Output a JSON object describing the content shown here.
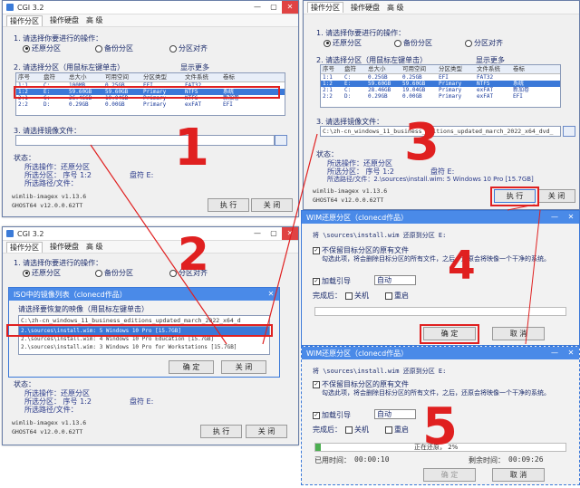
{
  "app_title": "CGI 3.2",
  "menu": {
    "tab1": "操作分区",
    "tab2": "操作硬盘",
    "tab3": "高 级"
  },
  "partition_cols": [
    "序号",
    "盘符",
    "总大小",
    "可用空间",
    "分区类型",
    "文件系统",
    "卷标"
  ],
  "panel1": {
    "section_op": "1. 请选择你要进行的操作：",
    "op_restore": "还原分区",
    "op_backup": "备份分区",
    "op_align": "分区对齐",
    "section_part": "2. 请选择分区（用鼠标左键单击）",
    "show_more": "显示更多",
    "section_image": "3. 请选择镜像文件：",
    "status_label": "状态：",
    "status_op": "所选操作：还原分区",
    "status_part_prefix": "所选分区：   序号 1:2",
    "status_drive": "盘符 E:",
    "status_image": "所选路径/文件：",
    "footer_version": "wimlib-imagex v1.13.6",
    "footer_ghost": "GHOST64 v12.0.0.62TT",
    "btn_exec": "执 行",
    "btn_close": "关 闭",
    "rows": [
      [
        "1:1",
        "C:",
        "100MB",
        "0.25GB",
        "EFI",
        "FAT32",
        ""
      ],
      [
        "1:2",
        "E:",
        "59.60GB",
        "59.60GB",
        "Primary",
        "NTFS",
        "系统"
      ],
      [
        "2:1",
        "C:",
        "26.46GB",
        "19.04GB",
        "Primary",
        "NTFS",
        "新加卷"
      ],
      [
        "2:2",
        "D:",
        "0.29GB",
        "0.00GB",
        "Primary",
        "exFAT",
        "EFI"
      ]
    ]
  },
  "panel2": {
    "rows": [
      [
        "1:1",
        "C:",
        "0.25GB",
        "0.25GB",
        "EFI",
        "FAT32",
        ""
      ],
      [
        "1:2",
        "E:",
        "59.60GB",
        "59.60GB",
        "Primary",
        "NTFS",
        "系统"
      ],
      [
        "2:1",
        "C:",
        "28.46GB",
        "19.04GB",
        "Primary",
        "exFAT",
        "新加卷"
      ],
      [
        "2:2",
        "D:",
        "0.29GB",
        "0.00GB",
        "Primary",
        "exFAT",
        "EFI"
      ]
    ],
    "image_path": "C:\\zh-cn_windows_11_business_editions_updated_march_2022_x64_dvd_",
    "status_image": "所选路径/文件：2.\\sources\\install.wim: 5  Windows 10 Pro [15.7GB]"
  },
  "iso_dialog": {
    "title": "ISO中的镜像列表（clonecd作品）",
    "subtitle": "请选择要恢复的映像（用鼠标左键单击）",
    "path": "C:\\zh-cn_windows_11_business_editions_updated_march_2022_x64_d",
    "items": [
      "2.\\sources\\install.wim: 5  Windows 10 Pro [15.7GB]",
      "2.\\sources\\install.wim: 4  Windows 10 Pro Education [15.7GB]",
      "2.\\sources\\install.wim: 3  Windows 10 Pro for Workstations [15.7GB]"
    ],
    "ok": "确 定",
    "close": "关 闭"
  },
  "panel4": {
    "title": "WIM还原分区（clonecd作品）",
    "msg": "将 \\sources\\install.wim 还原到分区 E:",
    "keep_label": "不保留目标分区的原有文件",
    "keep_desc": "勾选此项，将会删除目标分区的所有文件，之后，还原会将映像一个干净的系统。",
    "boot_label": "加载引导",
    "boot_value": "自动",
    "after_label": "完成后：",
    "shutdown": "关机",
    "restart": "重启",
    "ok": "确 定",
    "cancel": "取 消"
  },
  "panel5": {
    "title": "WIM还原分区（clonecd作品）",
    "msg": "将 \\sources\\install.wim 还原到分区 E:",
    "keep_label": "不保留目标分区的原有文件",
    "keep_desc": "勾选此项，将会删除目标分区的所有文件，之后，还原会将映像一个干净的系统。",
    "boot_label": "加载引导",
    "boot_value": "自动",
    "after_label": "完成后：",
    "shutdown": "关机",
    "restart": "重启",
    "progress_text": "正在还原，  2%",
    "progress_value": 0.02,
    "elapsed_label": "已用时间：",
    "elapsed": "00:00:10",
    "remain_label": "剩余时间：",
    "remain": "00:09:26",
    "ok": "确 定",
    "cancel": "取 消"
  },
  "steps": [
    "1",
    "2",
    "3",
    "4",
    "5"
  ],
  "colors": {
    "annotation": "#e02020",
    "selection": "#3a78d8",
    "progress": "#4caf50"
  }
}
